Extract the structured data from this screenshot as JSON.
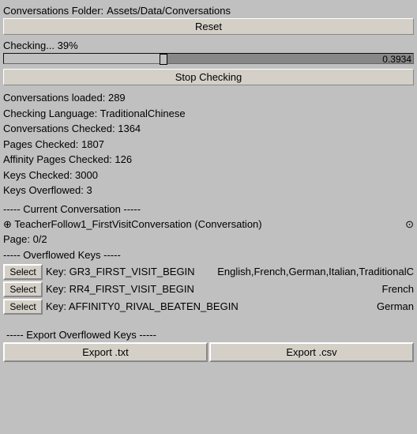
{
  "folder": {
    "label": "Conversations Folder:",
    "value": "Assets/Data/Conversations"
  },
  "reset": {
    "label": "Reset"
  },
  "progress": {
    "label": "Checking... 39%",
    "value": "0.3934",
    "percent": 39
  },
  "stop_button": {
    "label": "Stop Checking"
  },
  "info": {
    "conversations_loaded": "Conversations loaded: 289",
    "checking_language": "Checking Language: TraditionalChinese",
    "conversations_checked": "Conversations Checked: 1364",
    "pages_checked": "Pages Checked: 1807",
    "affinity_pages": "Affinity Pages Checked: 126",
    "keys_checked": "Keys Checked: 3000",
    "keys_overflowed": "Keys Overflowed: 3"
  },
  "current_conversation": {
    "divider": "----- Current Conversation -----",
    "name": "⊕ TeacherFollow1_FirstVisitConversation (Conversation)",
    "icon": "⊙",
    "page": "Page: 0/2"
  },
  "overflowed_keys": {
    "divider": "----- Overflowed Keys -----",
    "items": [
      {
        "select_label": "Select",
        "key": "Key: GR3_FIRST_VISIT_BEGIN",
        "languages": "English,French,German,Italian,TraditionalC"
      },
      {
        "select_label": "Select",
        "key": "Key: RR4_FIRST_VISIT_BEGIN",
        "languages": "French"
      },
      {
        "select_label": "Select",
        "key": "Key: AFFINITY0_RIVAL_BEATEN_BEGIN",
        "languages": "German"
      }
    ]
  },
  "export": {
    "divider": "----- Export Overflowed Keys -----",
    "txt_label": "Export .txt",
    "csv_label": "Export .csv"
  }
}
